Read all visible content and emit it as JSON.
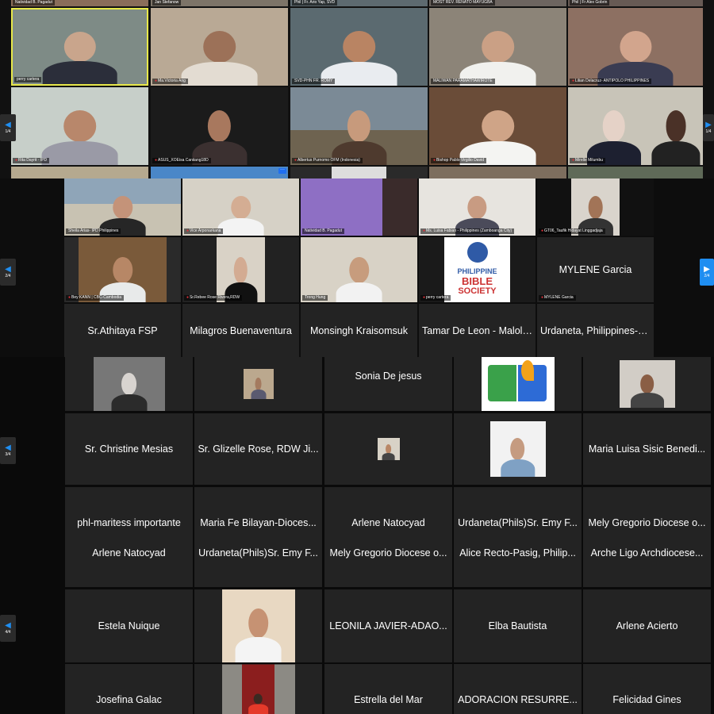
{
  "screen1": {
    "top_strip": [
      "Natividad B. Pagadut",
      "Jan Stefanow",
      "Phil | Fr. Ario Yap, SVD",
      "MOST REV. RENATO MAYUGBA",
      "Phil | Fr Alex Gobrin"
    ],
    "tiles": [
      "perry cartera",
      "Ma.Victoria Ang",
      "SVD-PHN FR. ROMY",
      "MALIWAN PARAMATHAWIROTE",
      "Lilian Delacruz- ANTIPOLO PHILIPPINES",
      "Rita Dayrit - IPD",
      "ASUS_XOEisa Caniiang18D",
      "Albertus Purnomo OFM (Indonesia)",
      "Bishop Pablo Virgilio David",
      "Mirelle Milumbu"
    ],
    "nav_left": "1/4",
    "nav_right": "1/4"
  },
  "screen2": {
    "tiles": [
      "Sheila Arias- IPD Philippines",
      "Vice Arponarkana",
      "Natividad B. Pagadut",
      "Ms. Luisa Fabian - Philippines (Zamboanga City)",
      "GT06_Taufik Hidayat Linggadjaja",
      "Bey KANN | CBC-Cambodia",
      "Sr.Rebee Rose Rivera,RDW",
      "Trong Hung",
      "perry cartera",
      "MYLENE Garcia"
    ],
    "name_tiles": [
      "Sr.Athitaya FSP",
      "Milagros Buenaventura",
      "Monsingh Kraisomsuk",
      "Tamar De Leon - Malolos",
      "Urdaneta, Philippines-s.c..."
    ],
    "mylene_big": "MYLENE Garcia",
    "pbs_line1": "PHILIPPINE",
    "pbs_line2": "BIBLE",
    "pbs_line3": "SOCIETY",
    "nav_left": "2/4",
    "nav_right": "2/4"
  },
  "screen3": {
    "sonia": "Sonia De jesus",
    "row2": [
      "Sr. Christine Mesias",
      "Sr. Glizelle Rose, RDW Ji...",
      "Maria Luisa Sisic Benedi..."
    ],
    "row3": [
      "phl-maritess importante",
      "Maria Fe Bilayan-Dioces...",
      "Arlene Natocyad",
      "Urdaneta(Phils)Sr. Emy F...",
      "Mely Gregorio Diocese o..."
    ],
    "nav_left": "3/4"
  },
  "screen4": {
    "row1": [
      "Arlene Natocyad",
      "Urdaneta(Phils)Sr. Emy F...",
      "Mely Gregorio Diocese o...",
      "Alice Recto-Pasig, Philip...",
      "Arche Ligo Archdiocese..."
    ],
    "row2": [
      "Estela Nuique",
      "LEONILA JAVIER-ADAO...",
      "Elba Bautista",
      "Arlene Acierto"
    ],
    "row3": [
      "Josefina Galac",
      "Estrella del Mar",
      "ADORACION RESURRE...",
      "Felicidad Gines"
    ],
    "nav_left": "4/4"
  },
  "colors": {
    "accent": "#1f8ef1",
    "active_speaker": "#e8e84a",
    "muted": "#e0323a"
  }
}
